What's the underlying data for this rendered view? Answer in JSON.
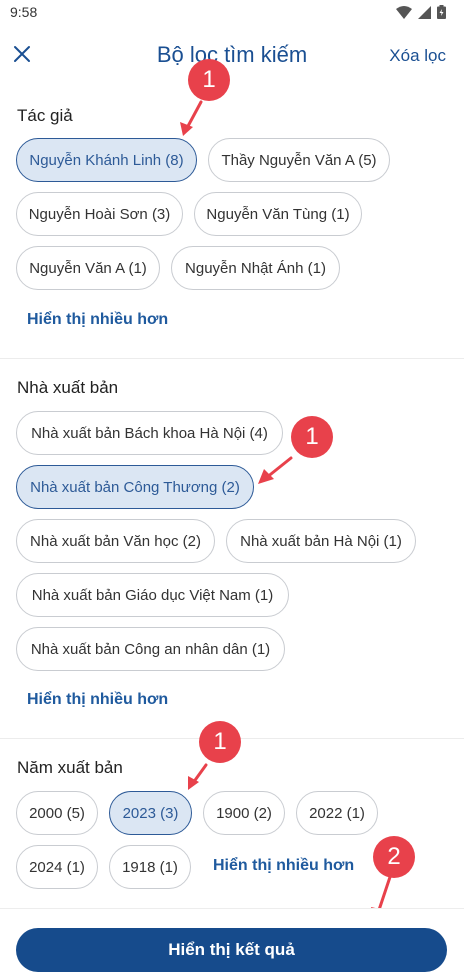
{
  "status": {
    "time": "9:58"
  },
  "header": {
    "title": "Bộ lọc tìm kiếm",
    "clear_label": "Xóa lọc"
  },
  "author": {
    "title": "Tác giả",
    "chips": [
      {
        "label": "Nguyễn Khánh Linh (8)",
        "selected": true
      },
      {
        "label": "Thầy Nguyễn Văn A (5)",
        "selected": false
      },
      {
        "label": "Nguyễn Hoài Sơn (3)",
        "selected": false
      },
      {
        "label": "Nguyễn Văn Tùng (1)",
        "selected": false
      },
      {
        "label": "Nguyễn Văn A (1)",
        "selected": false
      },
      {
        "label": "Nguyễn Nhật Ánh (1)",
        "selected": false
      }
    ],
    "more_label": "Hiển thị nhiều hơn"
  },
  "publisher": {
    "title": "Nhà xuất bản",
    "chips": [
      {
        "label": "Nhà xuất bản Bách khoa Hà Nội (4)",
        "selected": false
      },
      {
        "label": "Nhà xuất bản Công Thương (2)",
        "selected": true
      },
      {
        "label": "Nhà xuất bản Văn học (2)",
        "selected": false
      },
      {
        "label": "Nhà xuất bản Hà Nội (1)",
        "selected": false
      },
      {
        "label": "Nhà xuất bản Giáo dục Việt Nam (1)",
        "selected": false
      },
      {
        "label": "Nhà xuất bản Công an nhân dân (1)",
        "selected": false
      }
    ],
    "more_label": "Hiển thị nhiều hơn"
  },
  "year": {
    "title": "Năm xuất bản",
    "chips": [
      {
        "label": "2000 (5)",
        "selected": false
      },
      {
        "label": "2023 (3)",
        "selected": true
      },
      {
        "label": "1900 (2)",
        "selected": false
      },
      {
        "label": "2022 (1)",
        "selected": false
      },
      {
        "label": "2024 (1)",
        "selected": false
      },
      {
        "label": "1918 (1)",
        "selected": false
      }
    ],
    "more_label": "Hiển thị nhiều hơn"
  },
  "footer": {
    "result_label": "Hiển thị kết quả"
  },
  "annotations": {
    "step1": "1",
    "step2": "2"
  },
  "colors": {
    "accent": "#164b8c",
    "selected_bg": "#dbe6f3",
    "annotation": "#e8414b"
  }
}
